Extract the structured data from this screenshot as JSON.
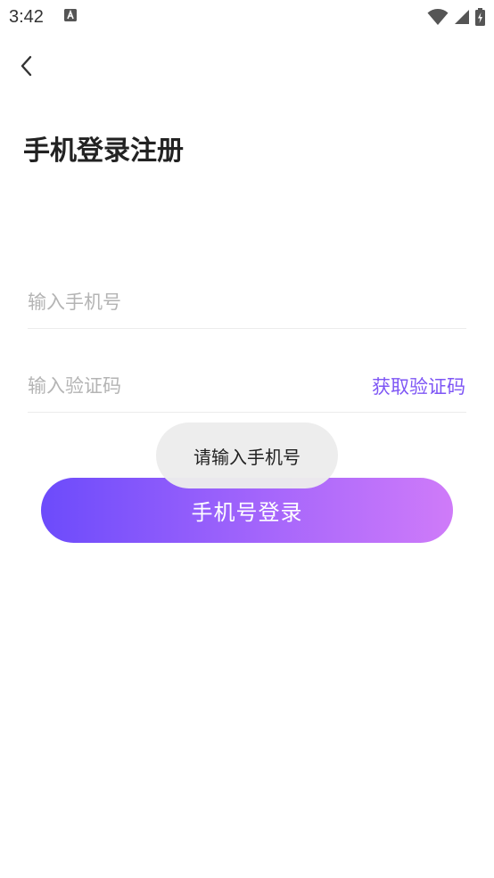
{
  "status_bar": {
    "time": "3:42",
    "icons": [
      "notification-a-icon",
      "wifi-icon",
      "signal-icon",
      "battery-charging-icon"
    ]
  },
  "header": {
    "back_icon": "chevron-left-icon",
    "title": "手机登录注册"
  },
  "form": {
    "phone": {
      "value": "",
      "placeholder": "输入手机号"
    },
    "code": {
      "value": "",
      "placeholder": "输入验证码"
    },
    "get_code_label": "获取验证码"
  },
  "login_button_label": "手机号登录",
  "toast_message": "请输入手机号",
  "colors": {
    "accent": "#7e56f5",
    "gradient_start": "#6c4bfb",
    "gradient_end": "#cf7bf9",
    "title_text": "#222222",
    "placeholder": "#b4b4b4",
    "divider": "#ececec",
    "toast_bg": "#ececec"
  }
}
